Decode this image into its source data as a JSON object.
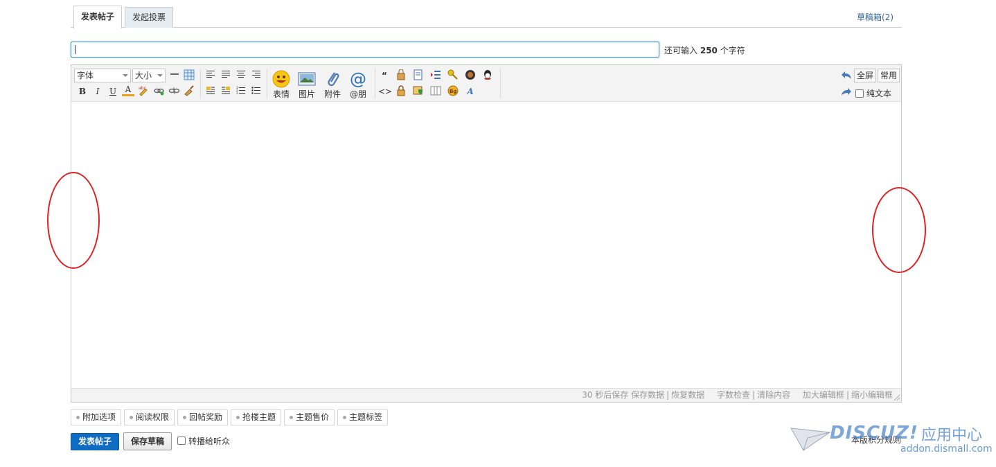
{
  "tabs": [
    {
      "label": "发表帖子",
      "active": true
    },
    {
      "label": "发起投票",
      "active": false
    }
  ],
  "drafts_link": "草稿箱(2)",
  "subject": {
    "value": "",
    "hint_prefix": "还可输入",
    "remaining": "250",
    "hint_suffix": "个字符"
  },
  "toolbar": {
    "font_select": "字体",
    "size_select": "大小",
    "fullscreen": "全屏",
    "common": "常用",
    "plain_text": "纯文本",
    "big_buttons": [
      "表情",
      "图片",
      "附件",
      "@朋"
    ],
    "format_buttons": [
      "B",
      "I",
      "U",
      "A"
    ]
  },
  "status_bar": {
    "autosave": "30 秒后保存",
    "save_data": "保存数据",
    "restore_data": "恢复数据",
    "word_check": "字数检查",
    "clear_content": "清除内容",
    "enlarge": "加大编辑框",
    "shrink": "缩小编辑框"
  },
  "extras": [
    "附加选项",
    "阅读权限",
    "回帖奖励",
    "抢楼主题",
    "主题售价",
    "主题标签"
  ],
  "actions": {
    "submit": "发表帖子",
    "save_draft": "保存草稿",
    "broadcast": "转播给听众",
    "rules": "本版积分规则"
  },
  "watermark": {
    "logo": "DISCUZ!",
    "cn": "应用中心",
    "url": "addon.dismall.com"
  },
  "colors": {
    "primary": "#0e6dc2",
    "annotation": "#e02020",
    "link": "#336699"
  }
}
